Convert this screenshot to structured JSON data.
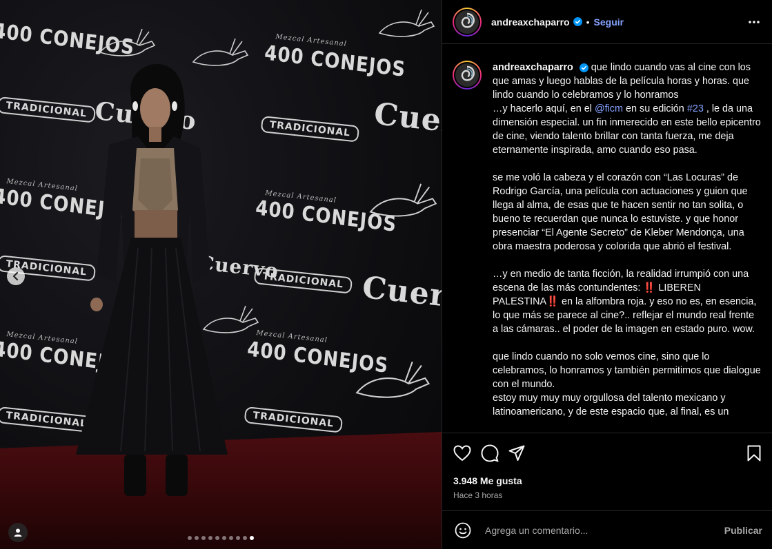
{
  "media": {
    "backdrop_brands": {
      "conejos": "400 CONEJOS",
      "conejos_sub": "Mezcal Artesanal",
      "cuervo": "Cuervo",
      "tradicional": "TRADICIONAL"
    },
    "carousel": {
      "total_slides": 10,
      "active_index": 9
    },
    "colors": {
      "carpet": "#3a0a0c",
      "backdrop": "#0e0e11"
    }
  },
  "header": {
    "username": "andreaxchaparro",
    "separator": "•",
    "follow_label": "Seguir"
  },
  "caption": {
    "username": "andreaxchaparro",
    "first_line": "que lindo cuando vas al cine con los que amas y luego hablas de la película horas y horas. que lindo cuando lo celebramos y lo honramos",
    "p1_before_mention": "…y hacerlo aquí, en el ",
    "mention": "@ficm",
    "p1_mid": " en su edición ",
    "hashtag": "#23",
    "p1_after": " , le da una dimensión especial. un fin inmerecido en este bello epicentro de cine, viendo talento brillar con tanta fuerza, me deja eternamente inspirada, amo cuando eso pasa.",
    "p2": "se me voló la cabeza y el corazón con “Las Locuras” de Rodrigo García, una película con actuaciones y guion que llega al alma, de esas que te hacen sentir no tan solita, o bueno te recuerdan que nunca lo estuviste. y que honor presenciar “El Agente Secreto” de Kleber Mendonça, una obra maestra poderosa y colorida que abrió el festival.",
    "p3_before": "…y en medio de tanta ficción, la realidad irrumpió con una escena de las más contundentes: ",
    "emoji_bang": "‼️",
    "p3_liberen": " LIBEREN PALESTINA",
    "p3_after": "  en la alfombra roja. y eso no es, en esencia, lo que más se parece al cine?.. reflejar el mundo real frente a las cámaras.. el poder de la imagen en estado puro. wow.",
    "p4": "que lindo cuando no solo vemos cine, sino que lo celebramos, lo honramos y también permitimos que dialogue con el mundo.",
    "p5": "estoy muy muy muy orgullosa del talento mexicano y latinoamericano, y de este espacio que, al final, es un"
  },
  "stats": {
    "likes": "3.948 Me gusta",
    "time": "Hace 3 horas"
  },
  "comment": {
    "placeholder": "Agrega un comentario...",
    "publish_label": "Publicar"
  },
  "colors": {
    "link": "#85a1ff",
    "verified": "#0095f6",
    "divider": "#262626",
    "muted": "#a8a8a8"
  }
}
